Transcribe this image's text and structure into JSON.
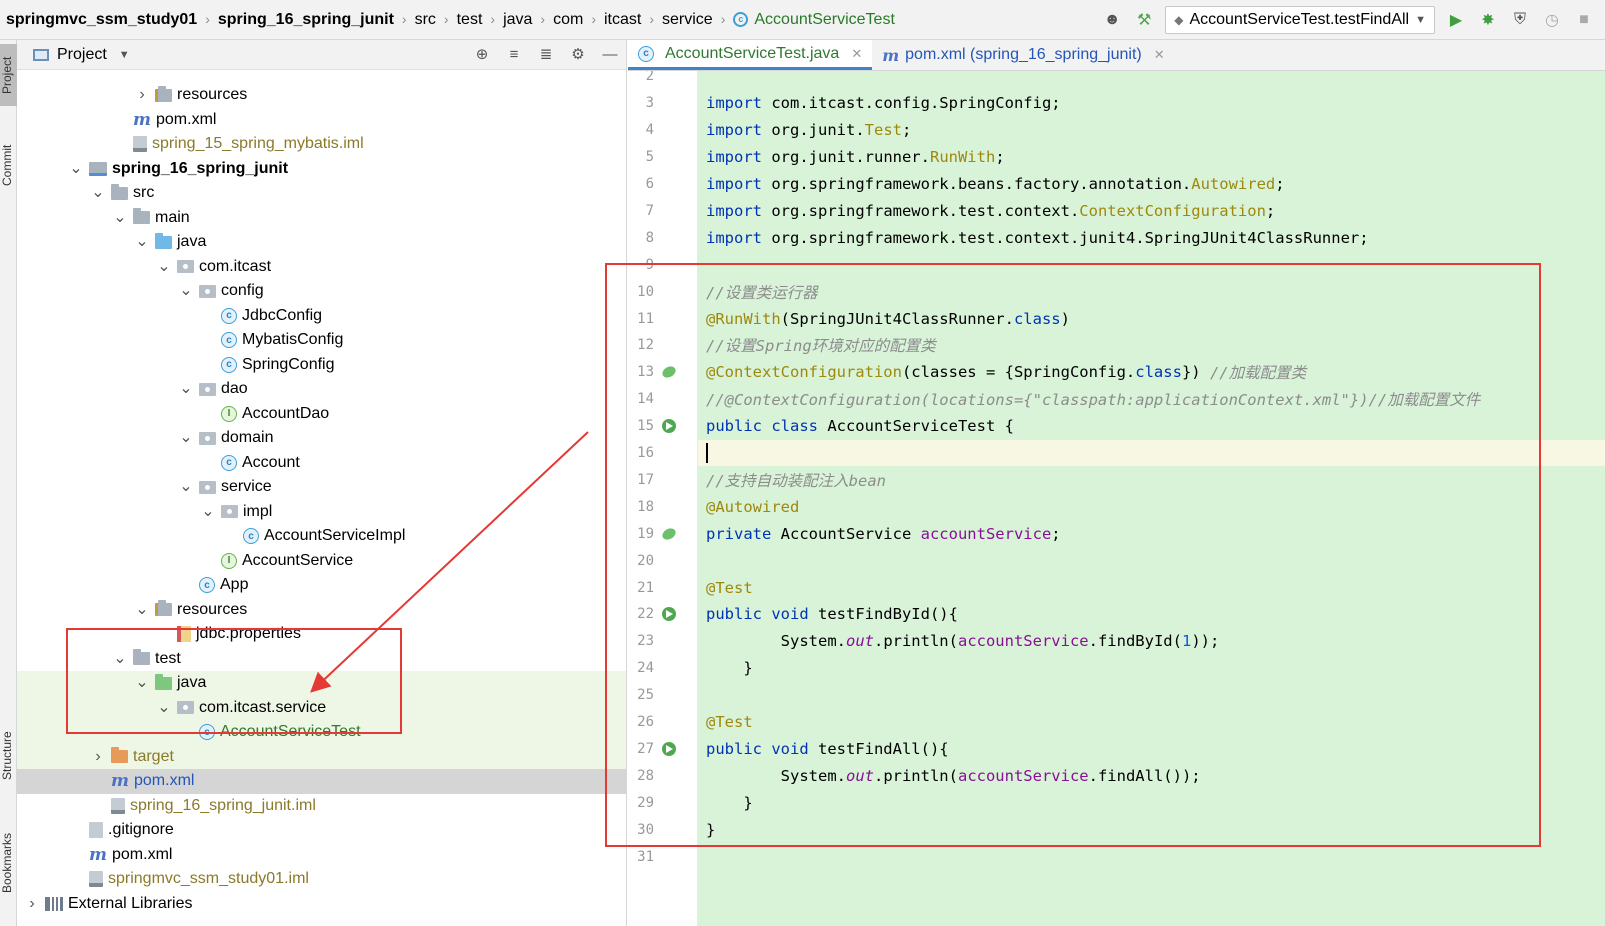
{
  "navbar": {
    "breadcrumbs": [
      "springmvc_ssm_study01",
      "spring_16_spring_junit",
      "src",
      "test",
      "java",
      "com",
      "itcast",
      "service",
      "AccountServiceTest"
    ],
    "run_config": "AccountServiceTest.testFindAll"
  },
  "left_strip": {
    "project": "Project",
    "commit": "Commit",
    "structure": "Structure",
    "bookmarks": "Bookmarks"
  },
  "project_panel": {
    "title": "Project",
    "tree": [
      {
        "label": "resources",
        "icon": "folder-res",
        "arrow": "right",
        "indent": 5
      },
      {
        "label": "pom.xml",
        "icon": "pom",
        "arrow": "none",
        "indent": 4
      },
      {
        "label": "spring_15_spring_mybatis.iml",
        "icon": "iml",
        "arrow": "none",
        "indent": 4,
        "style": "olive"
      },
      {
        "label": "spring_16_spring_junit",
        "icon": "module",
        "arrow": "down",
        "indent": 2,
        "style": "bold"
      },
      {
        "label": "src",
        "icon": "folder",
        "arrow": "down",
        "indent": 3
      },
      {
        "label": "main",
        "icon": "folder",
        "arrow": "down",
        "indent": 4
      },
      {
        "label": "java",
        "icon": "folder-src",
        "arrow": "down",
        "indent": 5
      },
      {
        "label": "com.itcast",
        "icon": "package",
        "arrow": "down",
        "indent": 6
      },
      {
        "label": "config",
        "icon": "package",
        "arrow": "down",
        "indent": 7
      },
      {
        "label": "JdbcConfig",
        "icon": "class",
        "arrow": "none",
        "indent": 8
      },
      {
        "label": "MybatisConfig",
        "icon": "class",
        "arrow": "none",
        "indent": 8
      },
      {
        "label": "SpringConfig",
        "icon": "class",
        "arrow": "none",
        "indent": 8
      },
      {
        "label": "dao",
        "icon": "package",
        "arrow": "down",
        "indent": 7
      },
      {
        "label": "AccountDao",
        "icon": "interface",
        "arrow": "none",
        "indent": 8
      },
      {
        "label": "domain",
        "icon": "package",
        "arrow": "down",
        "indent": 7
      },
      {
        "label": "Account",
        "icon": "class",
        "arrow": "none",
        "indent": 8
      },
      {
        "label": "service",
        "icon": "package",
        "arrow": "down",
        "indent": 7
      },
      {
        "label": "impl",
        "icon": "package",
        "arrow": "down",
        "indent": 8
      },
      {
        "label": "AccountServiceImpl",
        "icon": "class",
        "arrow": "none",
        "indent": 9
      },
      {
        "label": "AccountService",
        "icon": "interface",
        "arrow": "none",
        "indent": 8
      },
      {
        "label": "App",
        "icon": "class",
        "arrow": "none",
        "indent": 7
      },
      {
        "label": "resources",
        "icon": "folder-res",
        "arrow": "down",
        "indent": 5
      },
      {
        "label": "jdbc.properties",
        "icon": "props",
        "arrow": "none",
        "indent": 6
      },
      {
        "label": "test",
        "icon": "folder",
        "arrow": "down",
        "indent": 4
      },
      {
        "label": "java",
        "icon": "folder-test",
        "arrow": "down",
        "indent": 5,
        "row": "hl"
      },
      {
        "label": "com.itcast.service",
        "icon": "package",
        "arrow": "down",
        "indent": 6,
        "row": "hl"
      },
      {
        "label": "AccountServiceTest",
        "icon": "class",
        "arrow": "none",
        "indent": 7,
        "style": "green",
        "row": "hl"
      },
      {
        "label": "target",
        "icon": "folder-excl",
        "arrow": "right",
        "indent": 3,
        "style": "olive",
        "row": "hl"
      },
      {
        "label": "pom.xml",
        "icon": "pom",
        "arrow": "none",
        "indent": 3,
        "style": "blue",
        "row": "sel"
      },
      {
        "label": "spring_16_spring_junit.iml",
        "icon": "iml",
        "arrow": "none",
        "indent": 3,
        "style": "olive"
      },
      {
        "label": ".gitignore",
        "icon": "git",
        "arrow": "none",
        "indent": 2
      },
      {
        "label": "pom.xml",
        "icon": "pom",
        "arrow": "none",
        "indent": 2
      },
      {
        "label": "springmvc_ssm_study01.iml",
        "icon": "iml",
        "arrow": "none",
        "indent": 2,
        "style": "olive"
      },
      {
        "label": "External Libraries",
        "icon": "lib",
        "arrow": "right",
        "indent": 0
      }
    ]
  },
  "editor_tabs": [
    {
      "label": "AccountServiceTest.java",
      "active": true
    },
    {
      "label": "pom.xml (spring_16_spring_junit)",
      "active": false
    }
  ],
  "editor": {
    "lines": [
      {
        "n": "2",
        "mark": "",
        "html": ""
      },
      {
        "n": "3",
        "mark": "",
        "html": "<span class='kw'>import</span> com.itcast.config.SpringConfig;"
      },
      {
        "n": "4",
        "mark": "",
        "html": "<span class='kw'>import</span> org.junit.<span class='ann'>Test</span>;"
      },
      {
        "n": "5",
        "mark": "",
        "html": "<span class='kw'>import</span> org.junit.runner.<span class='ann'>RunWith</span>;"
      },
      {
        "n": "6",
        "mark": "",
        "html": "<span class='kw'>import</span> org.springframework.beans.factory.annotation.<span class='ann'>Autowired</span>;"
      },
      {
        "n": "7",
        "mark": "",
        "html": "<span class='kw'>import</span> org.springframework.test.context.<span class='ann'>ContextConfiguration</span>;"
      },
      {
        "n": "8",
        "mark": "",
        "html": "<span class='kw'>import</span> org.springframework.test.context.junit4.SpringJUnit4ClassRunner;"
      },
      {
        "n": "9",
        "mark": "",
        "html": ""
      },
      {
        "n": "10",
        "mark": "",
        "html": "<span class='cmt'>//设置类运行器</span>"
      },
      {
        "n": "11",
        "mark": "",
        "html": "<span class='ann'>@RunWith</span>(SpringJUnit4ClassRunner.<span class='kw'>class</span>)"
      },
      {
        "n": "12",
        "mark": "",
        "html": "<span class='cmt'>//设置Spring环境对应的配置类</span>"
      },
      {
        "n": "13",
        "mark": "bean",
        "html": "<span class='ann'>@ContextConfiguration</span>(classes = {SpringConfig.<span class='kw'>class</span>}) <span class='cmt'>//加载配置类</span>"
      },
      {
        "n": "14",
        "mark": "",
        "html": "<span class='cmt'>//@ContextConfiguration(locations={\"classpath:applicationContext.xml\"})//加载配置文件</span>"
      },
      {
        "n": "15",
        "mark": "run",
        "html": "<span class='kw'>public class</span> AccountServiceTest {"
      },
      {
        "n": "16",
        "mark": "",
        "html": "<span class='cursor'></span>",
        "caret": true
      },
      {
        "n": "17",
        "mark": "",
        "html": "    <span class='cmt'>//支持自动装配注入bean</span>"
      },
      {
        "n": "18",
        "mark": "",
        "html": "    <span class='ann'>@Autowired</span>"
      },
      {
        "n": "19",
        "mark": "bean",
        "html": "    <span class='kw'>private</span> AccountService <span class='fld'>accountService</span>;"
      },
      {
        "n": "20",
        "mark": "",
        "html": ""
      },
      {
        "n": "21",
        "mark": "",
        "html": "    <span class='ann'>@Test</span>"
      },
      {
        "n": "22",
        "mark": "run",
        "html": "    <span class='kw'>public void</span> testFindById(){"
      },
      {
        "n": "23",
        "mark": "",
        "html": "        System.<span class='it'>out</span>.println(<span class='fld'>accountService</span>.findById(<span class='num'>1</span>));"
      },
      {
        "n": "24",
        "mark": "",
        "html": "    }"
      },
      {
        "n": "25",
        "mark": "",
        "html": ""
      },
      {
        "n": "26",
        "mark": "",
        "html": "    <span class='ann'>@Test</span>"
      },
      {
        "n": "27",
        "mark": "run",
        "html": "    <span class='kw'>public void</span> testFindAll(){"
      },
      {
        "n": "28",
        "mark": "",
        "html": "        System.<span class='it'>out</span>.println(<span class='fld'>accountService</span>.findAll());"
      },
      {
        "n": "29",
        "mark": "",
        "html": "    }"
      },
      {
        "n": "30",
        "mark": "",
        "html": "}"
      },
      {
        "n": "31",
        "mark": "",
        "html": ""
      }
    ]
  },
  "colors": {
    "highlight_box": "#e53935",
    "code_bg": "#d9f3d9",
    "accent": "#4083c9"
  }
}
